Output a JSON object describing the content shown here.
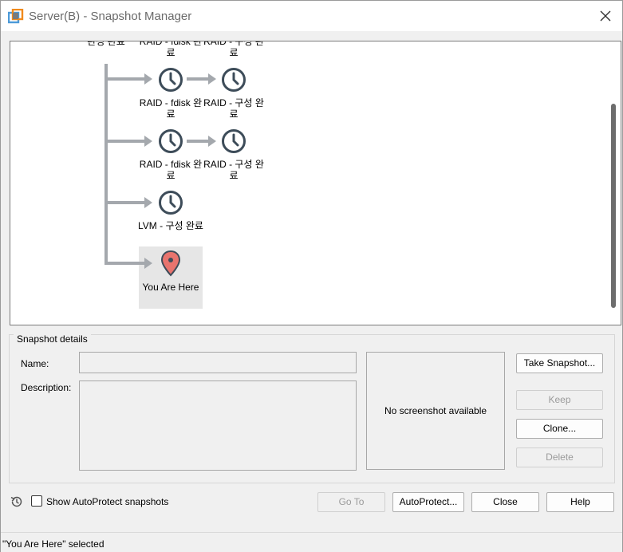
{
  "window": {
    "title": "Server(B) - Snapshot Manager"
  },
  "tree": {
    "top_partial_labels": [
      "완성 완료",
      "RAID - fdisk 완료",
      "RAID - 구성 완료"
    ],
    "rows": [
      {
        "snapshots": [
          "RAID - fdisk 완료",
          "RAID - 구성 완료"
        ]
      },
      {
        "snapshots": [
          "RAID - fdisk 완료",
          "RAID - 구성 완료"
        ]
      },
      {
        "snapshots": [
          "LVM - 구성 완료"
        ]
      }
    ],
    "current": "You Are Here",
    "current_icon": "location-pin-icon",
    "snapshot_icon": "clock-icon"
  },
  "details": {
    "legend": "Snapshot details",
    "name_label": "Name:",
    "name_value": "",
    "description_label": "Description:",
    "description_value": "",
    "screenshot_text": "No screenshot available"
  },
  "actions": {
    "take_snapshot": "Take Snapshot...",
    "keep": "Keep",
    "clone": "Clone...",
    "delete": "Delete"
  },
  "footer": {
    "show_autoprotect_label": "Show AutoProtect snapshots",
    "show_autoprotect_checked": false,
    "goto": "Go To",
    "autoprotect": "AutoProtect...",
    "close": "Close",
    "help": "Help"
  },
  "status": {
    "text": "\"You Are Here\" selected"
  },
  "colors": {
    "connector": "#a4a8ad",
    "clock": "#3d4c59",
    "pin": "#e8746e",
    "highlight": "#e6e6e6"
  }
}
